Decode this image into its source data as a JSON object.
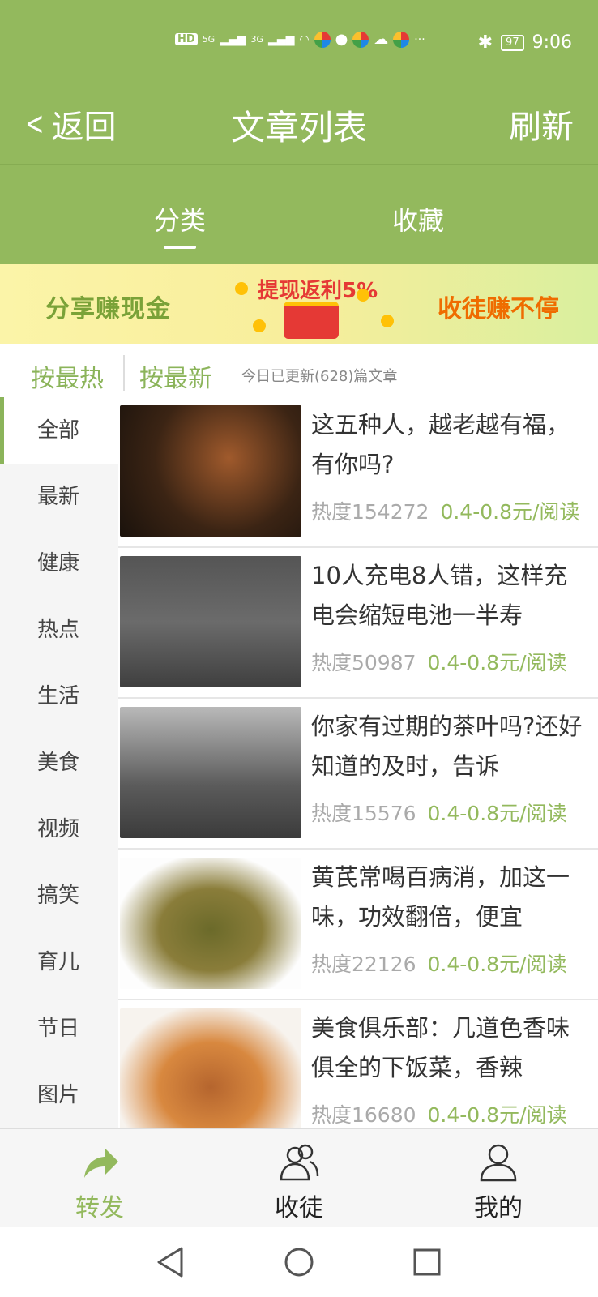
{
  "status_bar": {
    "hd": "HD",
    "signal1": "5G",
    "signal2": "3G",
    "more": "···",
    "bluetooth": "✱",
    "battery": "97",
    "time": "9:06"
  },
  "header": {
    "back_label": "返回",
    "title": "文章列表",
    "refresh_label": "刷新"
  },
  "tabs": [
    {
      "label": "分类"
    },
    {
      "label": "收藏"
    }
  ],
  "banner": {
    "left_text": "分享赚现金",
    "mid_text": "提现返利5%",
    "right_text": "收徒赚不停"
  },
  "sort": {
    "hot": "按最热",
    "new": "按最新",
    "info": "今日已更新(628)篇文章"
  },
  "sidebar": {
    "items": [
      {
        "label": "全部"
      },
      {
        "label": "最新"
      },
      {
        "label": "健康"
      },
      {
        "label": "热点"
      },
      {
        "label": "生活"
      },
      {
        "label": "美食"
      },
      {
        "label": "视频"
      },
      {
        "label": "搞笑"
      },
      {
        "label": "育儿"
      },
      {
        "label": "节日"
      },
      {
        "label": "图片"
      }
    ]
  },
  "articles": [
    {
      "title": "这五种人，越老越有福，有你吗?",
      "heat": "热度154272",
      "price": "0.4-0.8元/阅读"
    },
    {
      "title": "10人充电8人错，这样充电会缩短电池一半寿",
      "heat": "热度50987",
      "price": "0.4-0.8元/阅读"
    },
    {
      "title": "你家有过期的茶叶吗?还好知道的及时，告诉",
      "heat": "热度15576",
      "price": "0.4-0.8元/阅读"
    },
    {
      "title": "黄芪常喝百病消，加这一味，功效翻倍，便宜",
      "heat": "热度22126",
      "price": "0.4-0.8元/阅读"
    },
    {
      "title": "美食俱乐部：几道色香味俱全的下饭菜，香辣",
      "heat": "热度16680",
      "price": "0.4-0.8元/阅读"
    }
  ],
  "bottom_nav": {
    "share": "转发",
    "recruit": "收徒",
    "mine": "我的"
  },
  "colors": {
    "primary": "#93b95d",
    "accent_text": "#8bb45a"
  }
}
